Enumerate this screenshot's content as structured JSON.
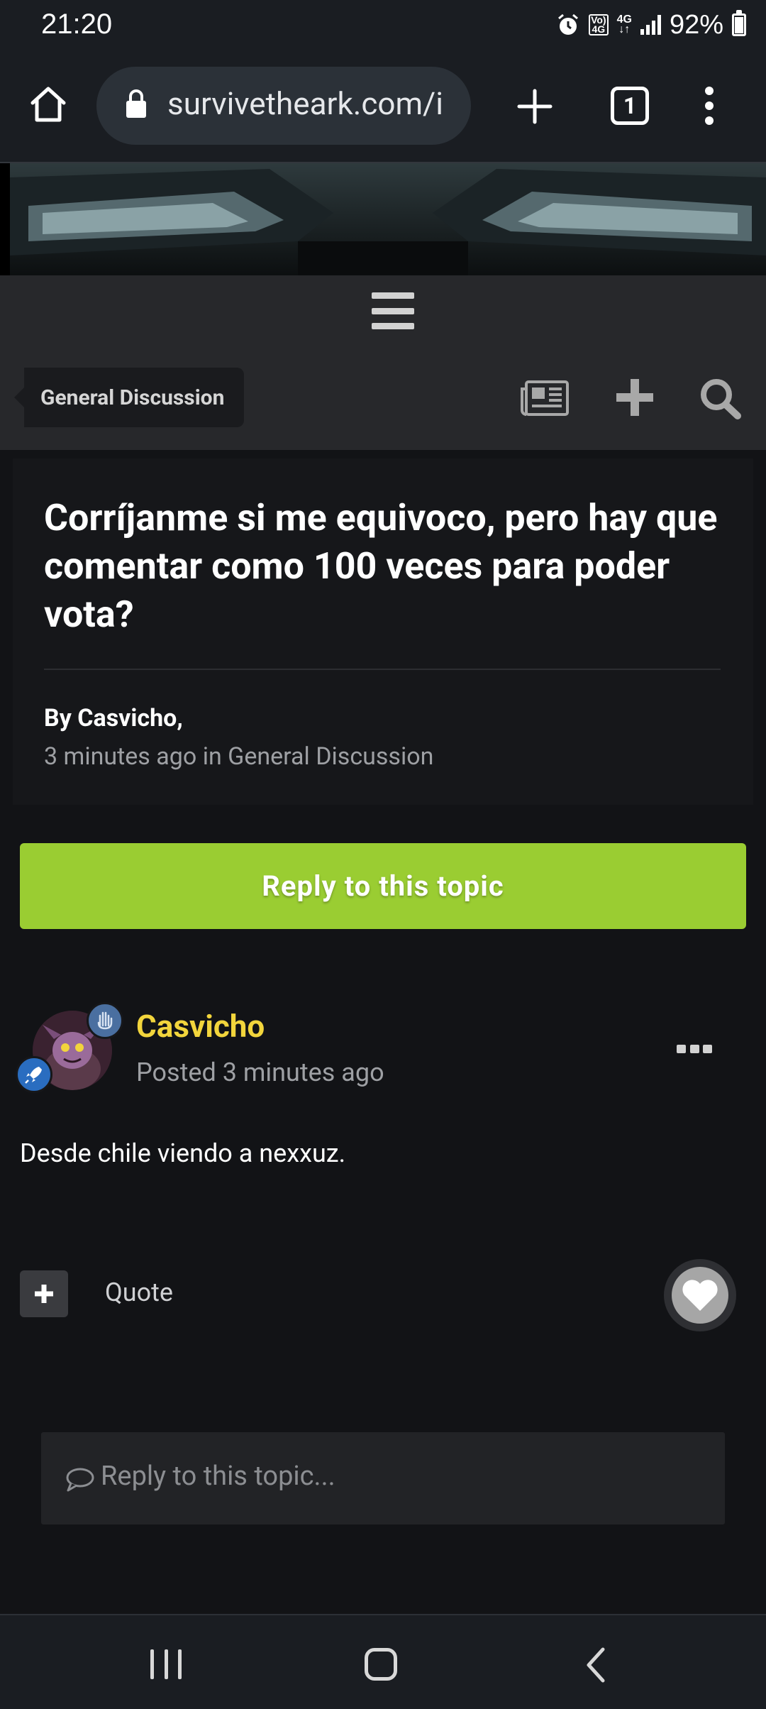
{
  "status_bar": {
    "time": "21:20",
    "battery": "92%",
    "network": "4G",
    "volte": "Vo) 4G",
    "icons": [
      "alarm-icon",
      "volte-icon",
      "data-4g-icon",
      "signal-icon",
      "battery-icon"
    ]
  },
  "browser": {
    "url": "survivetheark.com/i",
    "tab_count": "1",
    "icons": [
      "home-icon",
      "lock-icon",
      "new-tab-icon",
      "tabs-icon",
      "overflow-menu-icon"
    ]
  },
  "site_nav": {
    "breadcrumb": "General Discussion",
    "icons": [
      "hamburger-menu-icon",
      "activity-feed-icon",
      "create-icon",
      "search-icon"
    ]
  },
  "topic": {
    "title": "Corríjanme si me equivoco, pero hay que comentar como 100 veces para poder vota?",
    "author_line": "By Casvicho,",
    "meta": "3 minutes ago in General Discussion"
  },
  "reply_button": {
    "label": "Reply to this topic"
  },
  "post": {
    "author": "Casvicho",
    "posted": "Posted 3 minutes ago",
    "content": "Desde chile viendo a nexxuz.",
    "quote_label": "Quote",
    "author_color": "#f2d53c"
  },
  "reply_box": {
    "placeholder": "Reply to this topic..."
  },
  "colors": {
    "accent_green": "#9acd32",
    "background": "#121316",
    "author_yellow": "#f2d53c"
  }
}
